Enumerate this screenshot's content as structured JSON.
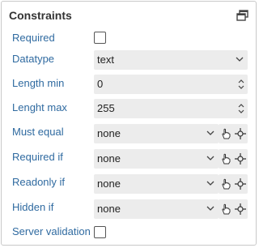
{
  "panel": {
    "title": "Constraints",
    "restore_icon": "restore-window-icon"
  },
  "fields": {
    "required": {
      "label": "Required",
      "checked": false
    },
    "datatype": {
      "label": "Datatype",
      "value": "text"
    },
    "length_min": {
      "label": "Length min",
      "value": "0"
    },
    "length_max": {
      "label": "Lenght max",
      "value": "255"
    },
    "must_equal": {
      "label": "Must equal",
      "value": "none"
    },
    "required_if": {
      "label": "Required if",
      "value": "none"
    },
    "readonly_if": {
      "label": "Readonly if",
      "value": "none"
    },
    "hidden_if": {
      "label": "Hidden if",
      "value": "none"
    },
    "server_validation": {
      "label": "Server validation",
      "checked": false
    }
  },
  "icons": {
    "dropdown": "chevron-down-icon",
    "spinner": "spinner-arrows-icon",
    "pointer": "hand-pointer-icon",
    "target": "crosshair-icon"
  }
}
